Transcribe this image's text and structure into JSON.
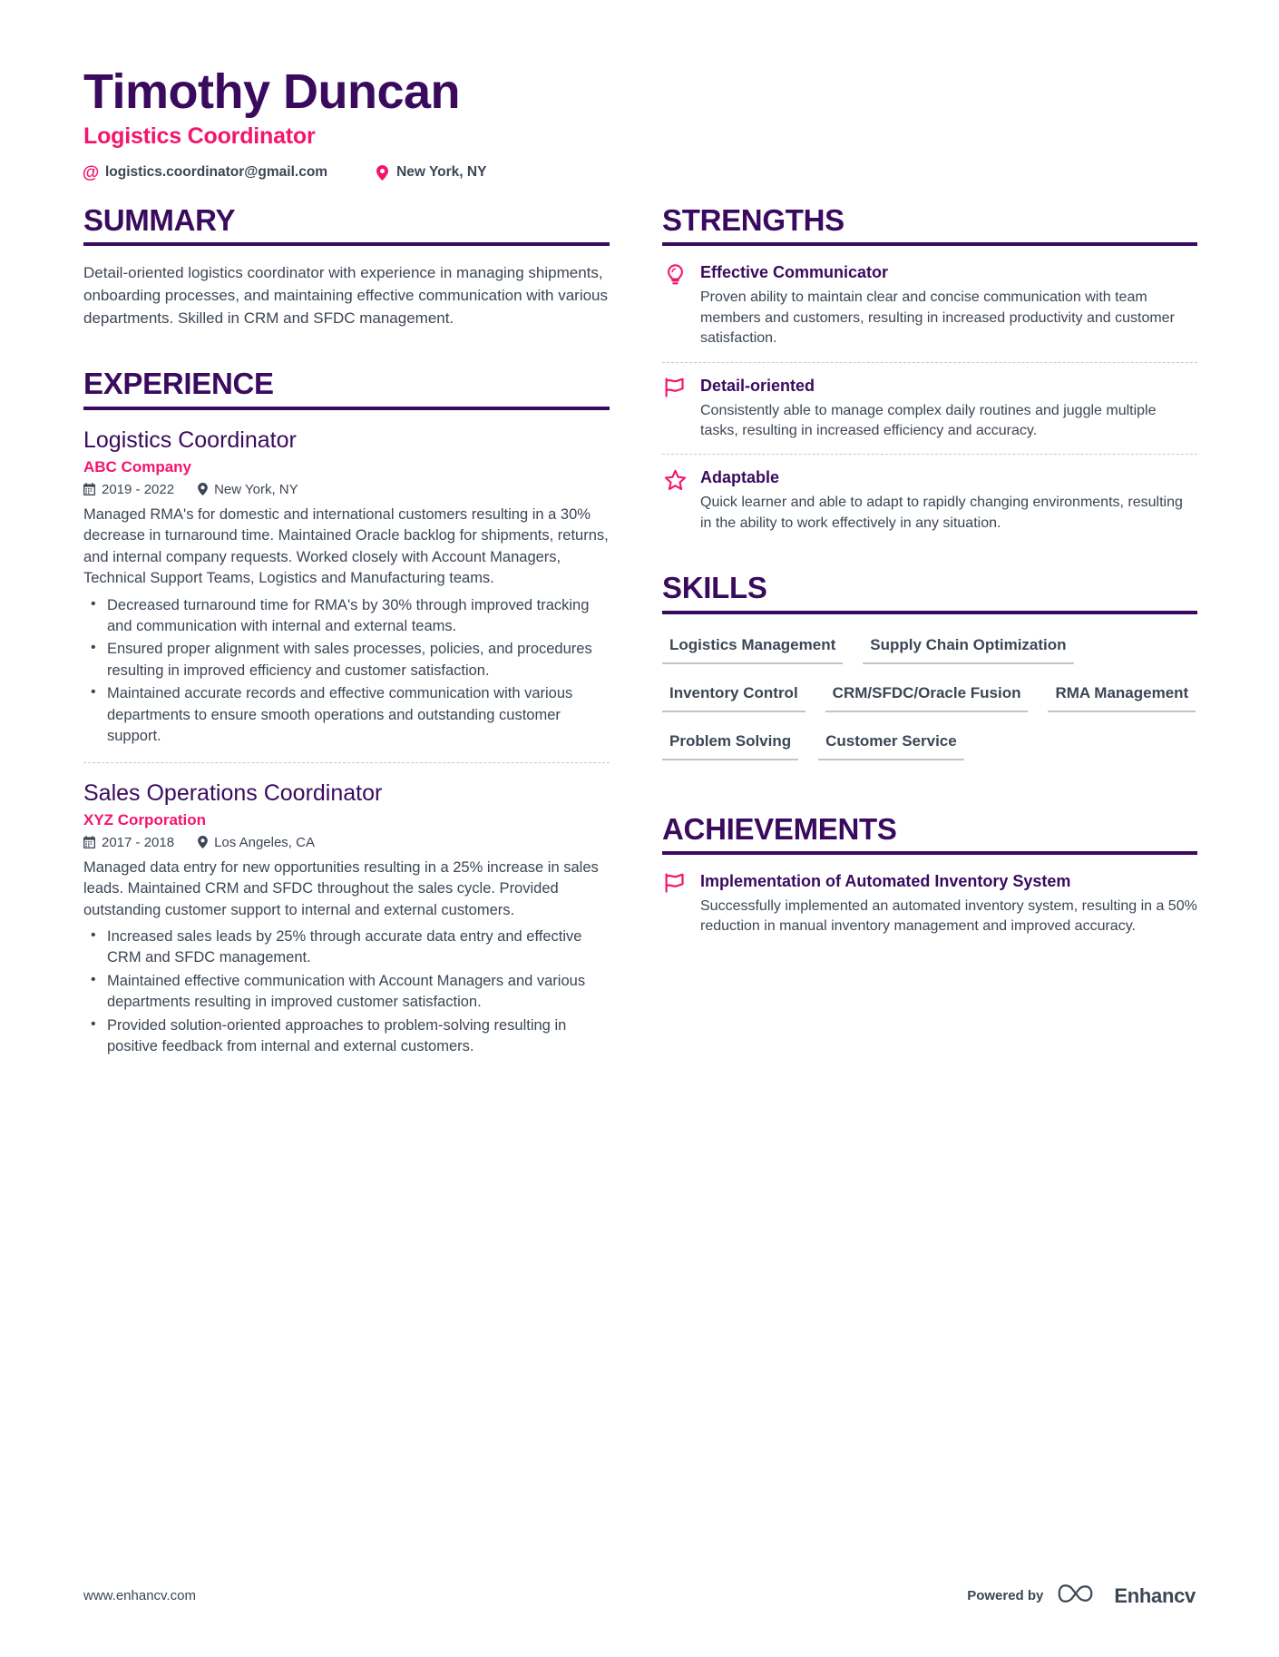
{
  "header": {
    "full_name": "Timothy Duncan",
    "job_title": "Logistics Coordinator",
    "contacts": [
      {
        "icon": "at-icon",
        "value": "logistics.coordinator@gmail.com"
      },
      {
        "icon": "location-pin-icon",
        "value": "New York, NY"
      }
    ]
  },
  "colors": {
    "heading_purple": "#3A0A5E",
    "accent_pink": "#F4156D",
    "body_text": "#3C4654",
    "rule_gray": "#C4C4C4"
  },
  "summary": {
    "title": "SUMMARY",
    "text": "Detail-oriented logistics coordinator with experience in managing shipments, onboarding processes, and maintaining effective communication with various departments. Skilled in CRM and SFDC management."
  },
  "experience": {
    "title": "EXPERIENCE",
    "entries": [
      {
        "role": "Logistics Coordinator",
        "company": "ABC Company",
        "dates": "2019 - 2022",
        "location": "New York, NY",
        "description": "Managed RMA's for domestic and international customers resulting in a 30% decrease in turnaround time. Maintained Oracle backlog for shipments, returns, and internal company requests. Worked closely with Account Managers, Technical Support Teams, Logistics and Manufacturing teams.",
        "bullets": [
          "Decreased turnaround time for RMA's by 30% through improved tracking and communication with internal and external teams.",
          "Ensured proper alignment with sales processes, policies, and procedures resulting in improved efficiency and customer satisfaction.",
          "Maintained accurate records and effective communication with various departments to ensure smooth operations and outstanding customer support."
        ]
      },
      {
        "role": "Sales Operations Coordinator",
        "company": "XYZ Corporation",
        "dates": "2017 - 2018",
        "location": "Los Angeles, CA",
        "description": "Managed data entry for new opportunities resulting in a 25% increase in sales leads. Maintained CRM and SFDC throughout the sales cycle. Provided outstanding customer support to internal and external customers.",
        "bullets": [
          "Increased sales leads by 25% through accurate data entry and effective CRM and SFDC management.",
          "Maintained effective communication with Account Managers and various departments resulting in improved customer satisfaction.",
          "Provided solution-oriented approaches to problem-solving resulting in positive feedback from internal and external customers."
        ]
      }
    ]
  },
  "strengths": {
    "title": "STRENGTHS",
    "items": [
      {
        "icon": "lightbulb-icon",
        "title": "Effective Communicator",
        "text": "Proven ability to maintain clear and concise communication with team members and customers, resulting in increased productivity and customer satisfaction."
      },
      {
        "icon": "flag-icon",
        "title": "Detail-oriented",
        "text": "Consistently able to manage complex daily routines and juggle multiple tasks, resulting in increased efficiency and accuracy."
      },
      {
        "icon": "star-icon",
        "title": "Adaptable",
        "text": "Quick learner and able to adapt to rapidly changing environments, resulting in the ability to work effectively in any situation."
      }
    ]
  },
  "skills": {
    "title": "SKILLS",
    "items": [
      "Logistics Management",
      "Supply Chain Optimization",
      "Inventory Control",
      "CRM/SFDC/Oracle Fusion",
      "RMA Management",
      "Problem Solving",
      "Customer Service"
    ]
  },
  "achievements": {
    "title": "ACHIEVEMENTS",
    "items": [
      {
        "icon": "flag-icon",
        "title": "Implementation of Automated Inventory System",
        "text": "Successfully implemented an automated inventory system, resulting in a 50% reduction in manual inventory management and improved accuracy."
      }
    ]
  },
  "footer": {
    "url": "www.enhancv.com",
    "powered_by": "Powered by",
    "brand": "Enhancv"
  }
}
